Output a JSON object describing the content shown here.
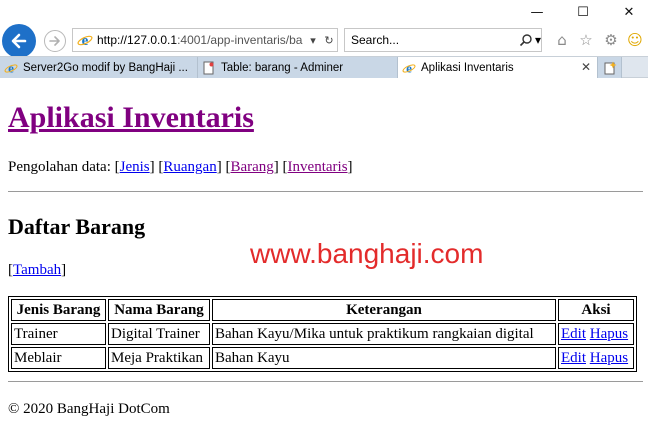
{
  "browser": {
    "url_host": "http://127.0.0.1",
    "url_rest": ":4001/app-inventaris/ba",
    "search_placeholder": "Search...",
    "tabs": [
      {
        "label": "Server2Go modif by BangHaji ..."
      },
      {
        "label": "Table: barang - Adminer"
      },
      {
        "label": "Aplikasi Inventaris"
      }
    ],
    "window_controls": {
      "minimize": "—",
      "maximize": "☐",
      "close": "✕"
    }
  },
  "page": {
    "title": "Aplikasi Inventaris",
    "menu_prefix": "Pengolahan data:",
    "menu": [
      {
        "label": "Jenis"
      },
      {
        "label": "Ruangan"
      },
      {
        "label": "Barang"
      },
      {
        "label": "Inventaris"
      }
    ],
    "section_title": "Daftar Barang",
    "watermark": "www.banghaji.com",
    "add_link": "Tambah",
    "table": {
      "headers": [
        "Jenis Barang",
        "Nama Barang",
        "Keterangan",
        "Aksi"
      ],
      "rows": [
        {
          "jenis": "Trainer",
          "nama": "Digital Trainer",
          "keterangan": "Bahan Kayu/Mika untuk praktikum rangkaian digital",
          "edit": "Edit",
          "hapus": "Hapus"
        },
        {
          "jenis": "Meblair",
          "nama": "Meja Praktikan",
          "keterangan": "Bahan Kayu",
          "edit": "Edit",
          "hapus": "Hapus"
        }
      ]
    },
    "footer": "© 2020 BangHaji DotCom"
  }
}
